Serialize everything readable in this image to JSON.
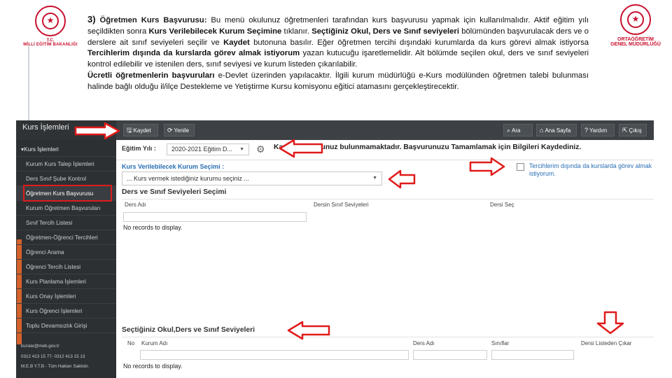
{
  "slide": {
    "logo_left": {
      "line1": "T.C.",
      "line2": "MİLLİ EĞİTİM BAKANLIĞI"
    },
    "logo_right": {
      "line1": "ORTAÖĞRETİM",
      "line2": "GENEL MÜDÜRLÜĞÜ"
    },
    "paragraph": {
      "number": "3)",
      "heading": "Öğretmen Kurs Başvurusu:",
      "t1": " Bu menü okulunuz öğretmenleri tarafından kurs başvurusu yapmak için kullanılmalıdır. Aktif eğitim yılı seçildikten sonra ",
      "b1": "Kurs Verilebilecek Kurum Seçimine",
      "t2": " tıklanır. ",
      "b2": "Seçtiğiniz Okul, Ders ve Sınıf seviyeleri",
      "t3": " bölümünden başvurulacak ders ve o derslere ait sınıf seviyeleri seçilir ve ",
      "b3": "Kaydet",
      "t4": " butonuna basılır. Eğer öğretmen tercihi dışındaki kurumlarda da kurs görevi almak istiyorsa ",
      "b4": "Tercihlerim dışında da kurslarda görev almak istiyorum",
      "t5": " yazan kutucuğu işaretlemelidir. Alt bölümde seçilen okul, ders ve sınıf seviyeleri kontrol edilebilir ve istenilen ders, sınıf seviyesi ve kurum listeden çıkarılabilir.",
      "b5": "Ücretli öğretmenlerin başvuruları",
      "t6": " e-Devlet üzerinden yapılacaktır. İlgili kurum müdürlüğü e-Kurs modülünden öğretmen talebi bulunması halinde bağlı olduğu il/ilçe Destekleme ve Yetiştirme Kursu komisyonu eğitici atamasını gerçekleştirecektir."
    }
  },
  "app": {
    "brand": "Kurs İşlemleri",
    "toolbar": {
      "save": "Kaydet",
      "refresh": "Yenile",
      "search": "Ara",
      "home": "Ana Sayfa",
      "help": "Yardım",
      "exit": "Çıkış"
    },
    "sidebar": {
      "items": [
        "Kurs İşlemleri",
        "Kurum Kurs Talep İşlemleri",
        "Ders Sınıf Şube Kontrol",
        "Öğretmen Kurs Başvurusu",
        "Kurum Öğretmen Başvuruları",
        "Sınıf Tercih Listesi",
        "Öğretmen-Öğrenci Tercihleri",
        "Öğrenci Arama",
        "Öğrenci Tercih Listesi",
        "Kurs Planlama İşlemleri",
        "Kurs Onay İşlemleri",
        "Kurs Öğrenci İşlemleri",
        "Toplu Devamsızlık Girişi"
      ],
      "footer": [
        "kurslar@meb.gov.tr",
        "0312 413 15 77- 0312 413 15 13",
        "M.E.B Y.T.B - Tüm Hakları Saklıdır."
      ]
    },
    "form": {
      "year_label": "Eğitim Yılı :",
      "year_value": "2020-2021 Eğitim D...",
      "message": "Kayıtlı başvurunuz bulunmamaktadır. Başvurunuzu Tamamlamak için Bilgileri Kaydediniz.",
      "institution_label": "Kurs Verilebilecek Kurum Seçimi :",
      "institution_placeholder": "... Kurs vermek istediğiniz kurumu seçiniz ...",
      "checkbox_label": "Tercihlerim dışında da kurslarda görev almak istiyorum.",
      "checkbox_checked": false,
      "section1_title": "Ders ve Sınıf Seviyeleri Seçimi",
      "table1_headers": [
        "Ders Adı",
        "Dersin Sınıf Seviyeleri",
        "Dersi Seç"
      ],
      "no_records": "No records to display.",
      "section2_title": "Seçtiğiniz Okul,Ders ve Sınıf Seviyeleri",
      "table2_headers": [
        "No",
        "Kurum Adı",
        "Ders Adı",
        "Sınıflar",
        "Dersi Listeden Çıkar"
      ],
      "no_records_2": "No records to display."
    },
    "colors": {
      "highlight": "#e01b1b",
      "link_blue": "#2a6fb3",
      "sidebar_bg": "#2d3033",
      "topbar_bg": "#3d4145"
    }
  }
}
